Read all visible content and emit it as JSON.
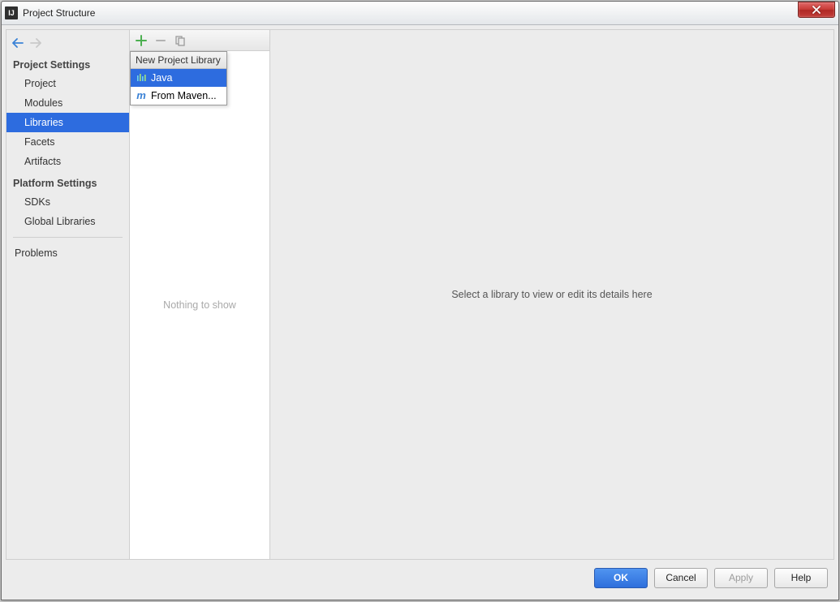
{
  "window": {
    "title": "Project Structure",
    "icon_text": "IJ"
  },
  "sidebar": {
    "sections": [
      {
        "title": "Project Settings",
        "items": [
          "Project",
          "Modules",
          "Libraries",
          "Facets",
          "Artifacts"
        ],
        "selected": "Libraries"
      },
      {
        "title": "Platform Settings",
        "items": [
          "SDKs",
          "Global Libraries"
        ]
      }
    ],
    "problems": "Problems"
  },
  "libraries": {
    "empty_text": "Nothing to show",
    "popup": {
      "header": "New Project Library",
      "items": [
        {
          "icon": "java",
          "label": "Java",
          "selected": true
        },
        {
          "icon": "maven",
          "label": "From Maven...",
          "selected": false
        }
      ]
    }
  },
  "detail": {
    "placeholder": "Select a library to view or edit its details here"
  },
  "footer": {
    "ok": "OK",
    "cancel": "Cancel",
    "apply": "Apply",
    "help": "Help"
  }
}
